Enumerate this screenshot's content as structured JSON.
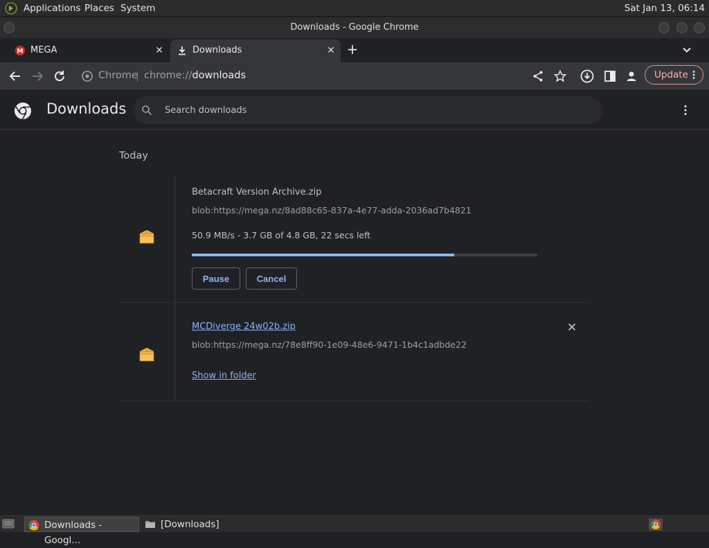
{
  "system_panel": {
    "menus": [
      "Applications",
      "Places",
      "System"
    ],
    "clock": "Sat Jan 13, 06:14"
  },
  "window": {
    "title": "Downloads - Google Chrome"
  },
  "tabs": [
    {
      "label": "MEGA",
      "icon": "mega-icon",
      "active": false
    },
    {
      "label": "Downloads",
      "icon": "download-icon",
      "active": true
    }
  ],
  "toolbar": {
    "omnibox_chrome_label": "Chrome",
    "url_scheme": "chrome://",
    "url_host": "downloads",
    "update_label": "Update"
  },
  "downloads_page": {
    "title": "Downloads",
    "search_placeholder": "Search downloads",
    "date_group": "Today",
    "items": [
      {
        "name": "Betacraft Version Archive.zip",
        "url": "blob:https://mega.nz/8ad88c65-837a-4e77-adda-2036ad7b4821",
        "status": "50.9 MB/s - 3.7 GB of 4.8 GB, 22 secs left",
        "progress_fraction": 0.76,
        "pause_label": "Pause",
        "cancel_label": "Cancel"
      },
      {
        "name": "MCDiverge 24w02b.zip",
        "url": "blob:https://mega.nz/78e8ff90-1e09-48e6-9471-1b4c1adbde22",
        "show_in_folder_label": "Show in folder"
      }
    ]
  },
  "taskbar": {
    "tasks": [
      {
        "label": "Downloads - Googl...",
        "icon": "chrome-icon"
      },
      {
        "label": "[Downloads]",
        "icon": "folder-icon"
      }
    ]
  },
  "colors": {
    "accent": "#8ab4f8",
    "background": "#202124",
    "update_border": "#e0948c"
  }
}
